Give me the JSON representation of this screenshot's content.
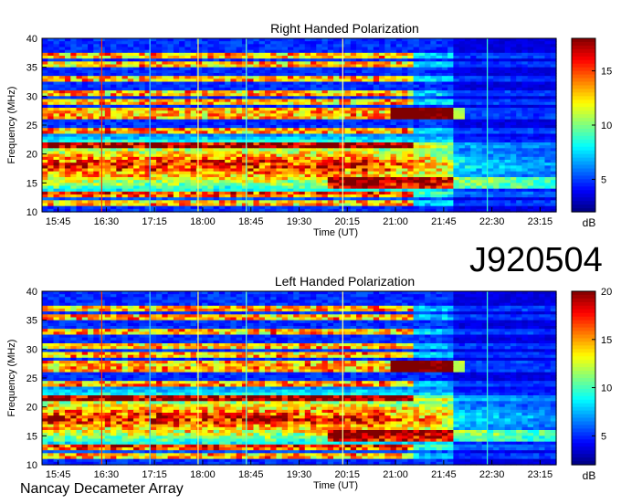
{
  "figure": {
    "observation_id": "J920504",
    "instrument": "Nancay Decameter Array"
  },
  "chart_data": [
    {
      "type": "heatmap",
      "title": "Right Handed Polarization",
      "xlabel": "Time (UT)",
      "ylabel": "Frequency (MHz)",
      "x_ticks": [
        "15:45",
        "16:30",
        "17:15",
        "18:00",
        "18:45",
        "19:30",
        "20:15",
        "21:00",
        "21:45",
        "22:30",
        "23:15"
      ],
      "y_ticks": [
        10,
        15,
        20,
        25,
        30,
        35,
        40
      ],
      "ylim": [
        10,
        40
      ],
      "xlim": [
        "15:30",
        "23:30"
      ],
      "colorbar": {
        "min": 2,
        "max": 18,
        "ticks": [
          5,
          10,
          15
        ],
        "unit": "dB",
        "colormap": "jet"
      }
    },
    {
      "type": "heatmap",
      "title": "Left Handed Polarization",
      "xlabel": "Time (UT)",
      "ylabel": "Frequency (MHz)",
      "x_ticks": [
        "15:45",
        "16:30",
        "17:15",
        "18:00",
        "18:45",
        "19:30",
        "20:15",
        "21:00",
        "21:45",
        "22:30",
        "23:15"
      ],
      "y_ticks": [
        10,
        15,
        20,
        25,
        30,
        35,
        40
      ],
      "ylim": [
        10,
        40
      ],
      "xlim": [
        "15:30",
        "23:30"
      ],
      "colorbar": {
        "min": 2,
        "max": 20,
        "ticks": [
          5,
          10,
          15,
          20
        ],
        "unit": "dB",
        "colormap": "jet"
      }
    }
  ]
}
